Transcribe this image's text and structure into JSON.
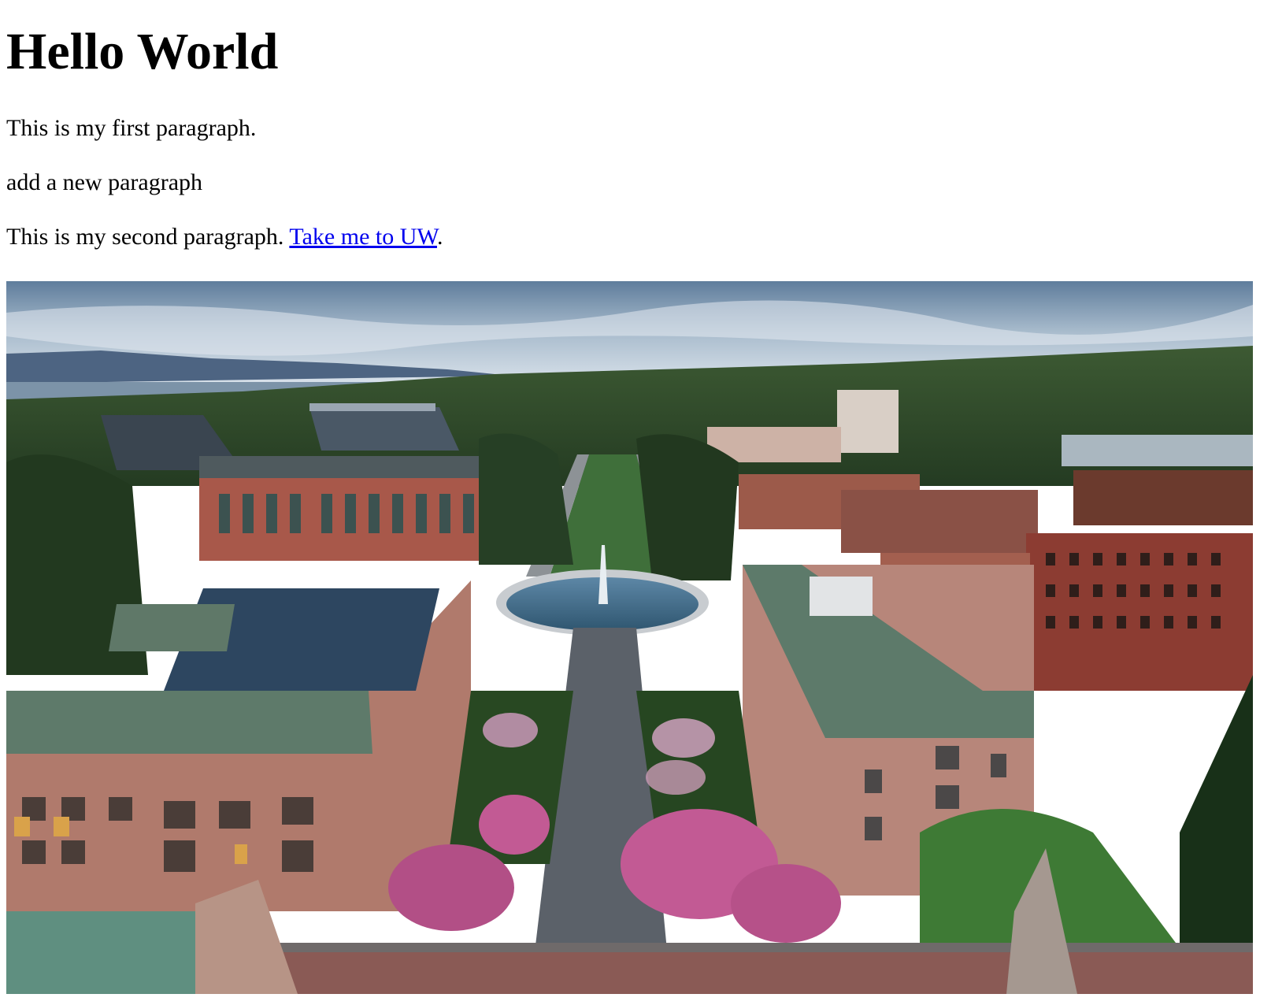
{
  "heading": "Hello World",
  "paragraphs": {
    "first": "This is my first paragraph.",
    "second": "add a new paragraph",
    "third_prefix": "This is my second paragraph. ",
    "third_suffix": "."
  },
  "link": {
    "text": "Take me to UW"
  },
  "image": {
    "subject": "aerial view of university campus quad with fountain, cherry blossoms, brick buildings, stadium, lake and mountains",
    "colors": {
      "sky_top": "#5f7d9c",
      "sky_bottom": "#d8e1ea",
      "mountains": "#4d6482",
      "lake": "#7c93a8",
      "forest": "#2f4a2c",
      "brick": "#a8584a",
      "stone": "#b7867a",
      "roof": "#5d7a6a",
      "blossom": "#c25a94",
      "path": "#5b6169",
      "fountain_pool": "#3f6b8a",
      "lawn": "#3f6f3a"
    }
  }
}
